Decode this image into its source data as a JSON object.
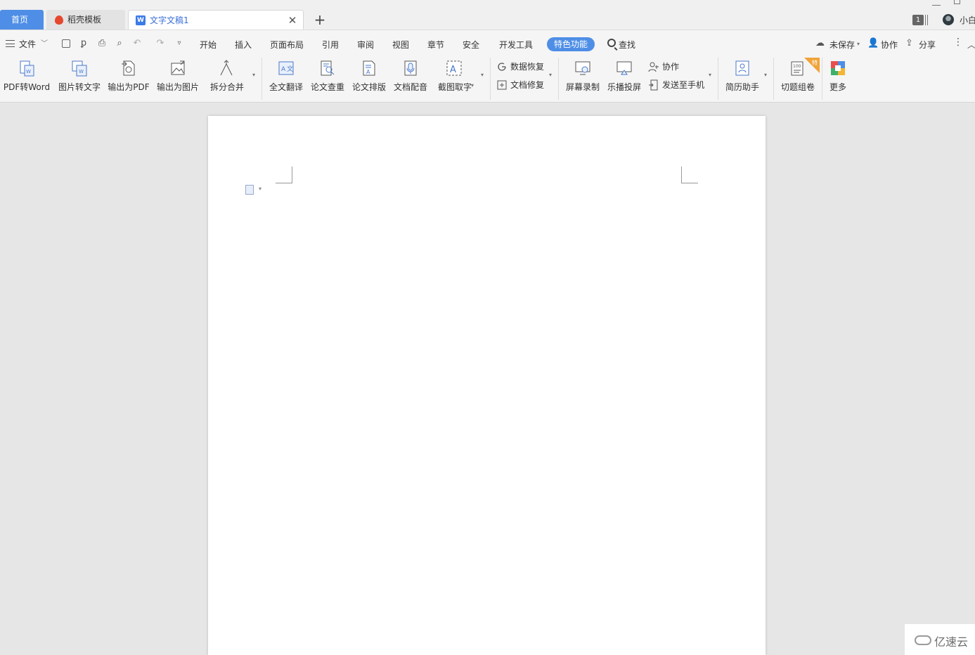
{
  "tabs": {
    "home": "首页",
    "template": "稻壳模板",
    "document": "文字文稿1",
    "page_count": "1",
    "user": "小白"
  },
  "menubar": {
    "file": "文件",
    "items": [
      "开始",
      "插入",
      "页面布局",
      "引用",
      "审阅",
      "视图",
      "章节",
      "安全",
      "开发工具"
    ],
    "active": "特色功能",
    "search": "查找",
    "unsaved": "未保存",
    "collab": "协作",
    "share": "分享"
  },
  "ribbon": {
    "pdf_to_word": "PDF转Word",
    "image_to_text": "图片转文字",
    "export_pdf": "输出为PDF",
    "export_image": "输出为图片",
    "split_merge": "拆分合并",
    "translate": "全文翻译",
    "paper_check": "论文查重",
    "paper_layout": "论文排版",
    "doc_audio": "文档配音",
    "screenshot_ocr": "截图取字",
    "data_recovery": "数据恢复",
    "doc_repair": "文档修复",
    "screen_record": "屏幕录制",
    "cast": "乐播投屏",
    "collab": "协作",
    "send_phone": "发送至手机",
    "resume": "简历助手",
    "quiz": "切题组卷",
    "more": "更多",
    "badge": "特"
  },
  "watermark": "亿速云",
  "colors": {
    "accent": "#4e8ee6",
    "tab_text": "#3a6fd8",
    "fire": "#e5472f"
  }
}
